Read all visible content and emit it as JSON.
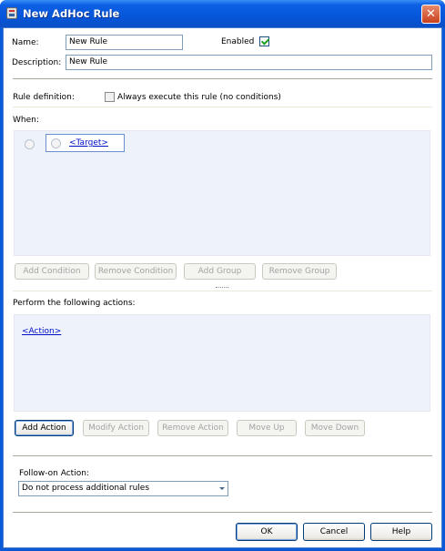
{
  "window": {
    "title": "New AdHoc Rule",
    "close_glyph": "✕"
  },
  "form": {
    "name_label": "Name:",
    "name_value": "New Rule",
    "enabled_label": "Enabled",
    "enabled_checked": true,
    "description_label": "Description:",
    "description_value": "New Rule"
  },
  "rule_definition": {
    "label": "Rule definition:",
    "always_execute_label": "Always execute this rule (no conditions)",
    "always_execute_checked": false
  },
  "when": {
    "label": "When:",
    "target_link": "<Target>",
    "buttons": {
      "add_condition": "Add Condition",
      "remove_condition": "Remove Condition",
      "add_group": "Add Group",
      "remove_group": "Remove Group"
    }
  },
  "actions": {
    "label": "Perform the following actions:",
    "action_link": "<Action>",
    "buttons": {
      "add_action": "Add Action",
      "modify_action": "Modify Action",
      "remove_action": "Remove Action",
      "move_up": "Move Up",
      "move_down": "Move Down"
    }
  },
  "follow_on": {
    "label": "Follow-on Action:",
    "selected": "Do not process additional rules"
  },
  "footer": {
    "ok": "OK",
    "cancel": "Cancel",
    "help": "Help"
  },
  "icons": [
    "app-icon",
    "close-icon",
    "radio-icon",
    "dropdown-arrow-icon",
    "checkmark-icon"
  ],
  "colors": {
    "title_bar": "#0656da",
    "link": "#0010c8",
    "panel": "#eef2fa"
  }
}
